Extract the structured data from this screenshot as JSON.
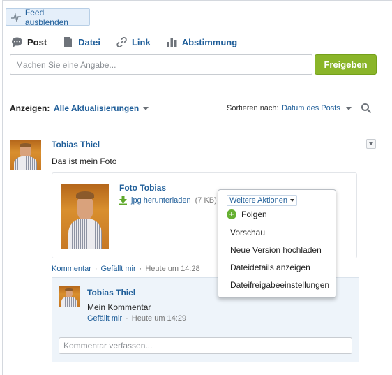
{
  "toolbar": {
    "feed_toggle_label": "Feed ausblenden"
  },
  "publisher": {
    "tabs": [
      {
        "label": "Post",
        "icon": "speech-bubble-icon"
      },
      {
        "label": "Datei",
        "icon": "file-icon"
      },
      {
        "label": "Link",
        "icon": "link-icon"
      },
      {
        "label": "Abstimmung",
        "icon": "poll-icon"
      }
    ],
    "input_placeholder": "Machen Sie eine Angabe...",
    "share_label": "Freigeben",
    "share_color": "#8ab529"
  },
  "filter": {
    "show_label": "Anzeigen:",
    "show_value": "Alle Aktualisierungen",
    "sort_label": "Sortieren nach:",
    "sort_value": "Datum des Posts"
  },
  "post": {
    "author": "Tobias Thiel",
    "text": "Das ist mein Foto",
    "attachment": {
      "title": "Foto Tobias",
      "download_label": "jpg herunterladen",
      "size": "(7 KB)"
    },
    "actions": {
      "comment": "Kommentar",
      "like": "Gefällt mir",
      "time": "Heute um 14:28",
      "sep": "·"
    }
  },
  "comment": {
    "author": "Tobias Thiel",
    "text": "Mein Kommentar",
    "like": "Gefällt mir",
    "time": "Heute um 14:29",
    "sep": "·",
    "input_placeholder": "Kommentar verfassen..."
  },
  "more_actions_menu": {
    "header": "Weitere Aktionen",
    "follow_label": "Folgen",
    "items": [
      "Vorschau",
      "Neue Version hochladen",
      "Dateidetails anzeigen",
      "Dateifreigabeeinstellungen"
    ]
  },
  "colors": {
    "link": "#1f5e99",
    "follow": "#66b032"
  }
}
